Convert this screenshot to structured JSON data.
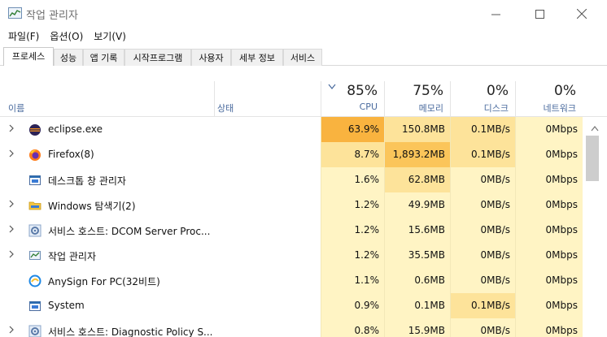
{
  "window": {
    "title": "작업 관리자"
  },
  "menu": [
    "파일(F)",
    "옵션(O)",
    "보기(V)"
  ],
  "tabs": [
    "프로세스",
    "성능",
    "앱 기록",
    "시작프로그램",
    "사용자",
    "세부 정보",
    "서비스"
  ],
  "columns": {
    "name": "이름",
    "status": "상태",
    "cpu": {
      "pct": "85%",
      "label": "CPU"
    },
    "memory": {
      "pct": "75%",
      "label": "메모리"
    },
    "disk": {
      "pct": "0%",
      "label": "디스크"
    },
    "network": {
      "pct": "0%",
      "label": "네트워크"
    }
  },
  "processes": [
    {
      "name": "eclipse.exe",
      "icon": "eclipse-icon",
      "expandable": true,
      "cpu": "63.9%",
      "memory": "150.8MB",
      "disk": "0.1MB/s",
      "network": "0Mbps"
    },
    {
      "name": "Firefox(8)",
      "icon": "firefox-icon",
      "expandable": true,
      "cpu": "8.7%",
      "memory": "1,893.2MB",
      "disk": "0.1MB/s",
      "network": "0Mbps"
    },
    {
      "name": "데스크톱 창 관리자",
      "icon": "window-icon",
      "expandable": false,
      "cpu": "1.6%",
      "memory": "62.8MB",
      "disk": "0MB/s",
      "network": "0Mbps"
    },
    {
      "name": "Windows 탐색기(2)",
      "icon": "folder-icon",
      "expandable": true,
      "cpu": "1.2%",
      "memory": "49.9MB",
      "disk": "0MB/s",
      "network": "0Mbps"
    },
    {
      "name": "서비스 호스트: DCOM Server Proc...",
      "icon": "gear-icon",
      "expandable": true,
      "cpu": "1.2%",
      "memory": "15.6MB",
      "disk": "0MB/s",
      "network": "0Mbps"
    },
    {
      "name": "작업 관리자",
      "icon": "taskmgr-icon",
      "expandable": true,
      "cpu": "1.2%",
      "memory": "35.5MB",
      "disk": "0MB/s",
      "network": "0Mbps"
    },
    {
      "name": "AnySign For PC(32비트)",
      "icon": "anysign-icon",
      "expandable": false,
      "cpu": "1.1%",
      "memory": "0.6MB",
      "disk": "0MB/s",
      "network": "0Mbps"
    },
    {
      "name": "System",
      "icon": "window-icon",
      "expandable": false,
      "cpu": "0.9%",
      "memory": "0.1MB",
      "disk": "0.1MB/s",
      "network": "0Mbps"
    },
    {
      "name": "서비스 호스트: Diagnostic Policy S...",
      "icon": "gear-icon",
      "expandable": true,
      "cpu": "0.8%",
      "memory": "15.9MB",
      "disk": "0MB/s",
      "network": "0Mbps"
    }
  ],
  "colors": {
    "heat_high": "#f9b33f",
    "heat_mid": "#fde39a",
    "heat_low": "#fff4c4",
    "heat_mem_high": "#fbc55a",
    "accent_text": "#4a6b9e"
  }
}
